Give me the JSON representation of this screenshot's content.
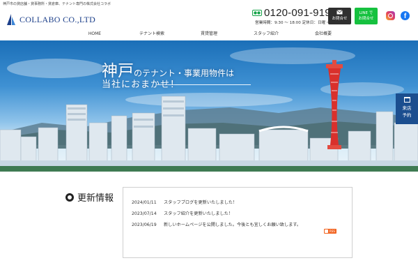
{
  "header": {
    "tagline": "神戸市の貸店舗・貸事務所・貸倉庫、テナント専門の株式会社コラボ",
    "logo_text": "COLLABO CO.,LTD",
    "phone": "0120-091-919",
    "hours": "営業時間：9:30 〜 18:00 定休日：日曜・祝日",
    "contact_label": "お問合せ",
    "line_label_1": "LINE で",
    "line_label_2": "お問合せ"
  },
  "nav": {
    "items": [
      {
        "label": "HOME"
      },
      {
        "label": "テナント検索"
      },
      {
        "label": "賃貸管理"
      },
      {
        "label": "スタッフ紹介"
      },
      {
        "label": "会社概要"
      }
    ]
  },
  "hero": {
    "line1_big": "神戸",
    "line1_rest": "のテナント・事業用物件は",
    "line2": "当社におまかせ！",
    "visit_label_1": "来店",
    "visit_label_2": "予約"
  },
  "news": {
    "title": "更新情報",
    "items": [
      {
        "date": "2024/01/11",
        "text": "スタッフブログを更新いたしました！"
      },
      {
        "date": "2023/07/14",
        "text": "スタッフ紹介を更新いたしました！"
      },
      {
        "date": "2023/06/19",
        "text": "新しいホームページを公開しました。今後とも宜しくお願い致します。"
      }
    ],
    "rss_label": "RSS"
  },
  "colors": {
    "logo_blue": "#1c3f8a",
    "line_green": "#16c13f",
    "facebook_blue": "#1877f2",
    "visit_tab": "#1b4e8f",
    "tower_red": "#d9302c"
  }
}
